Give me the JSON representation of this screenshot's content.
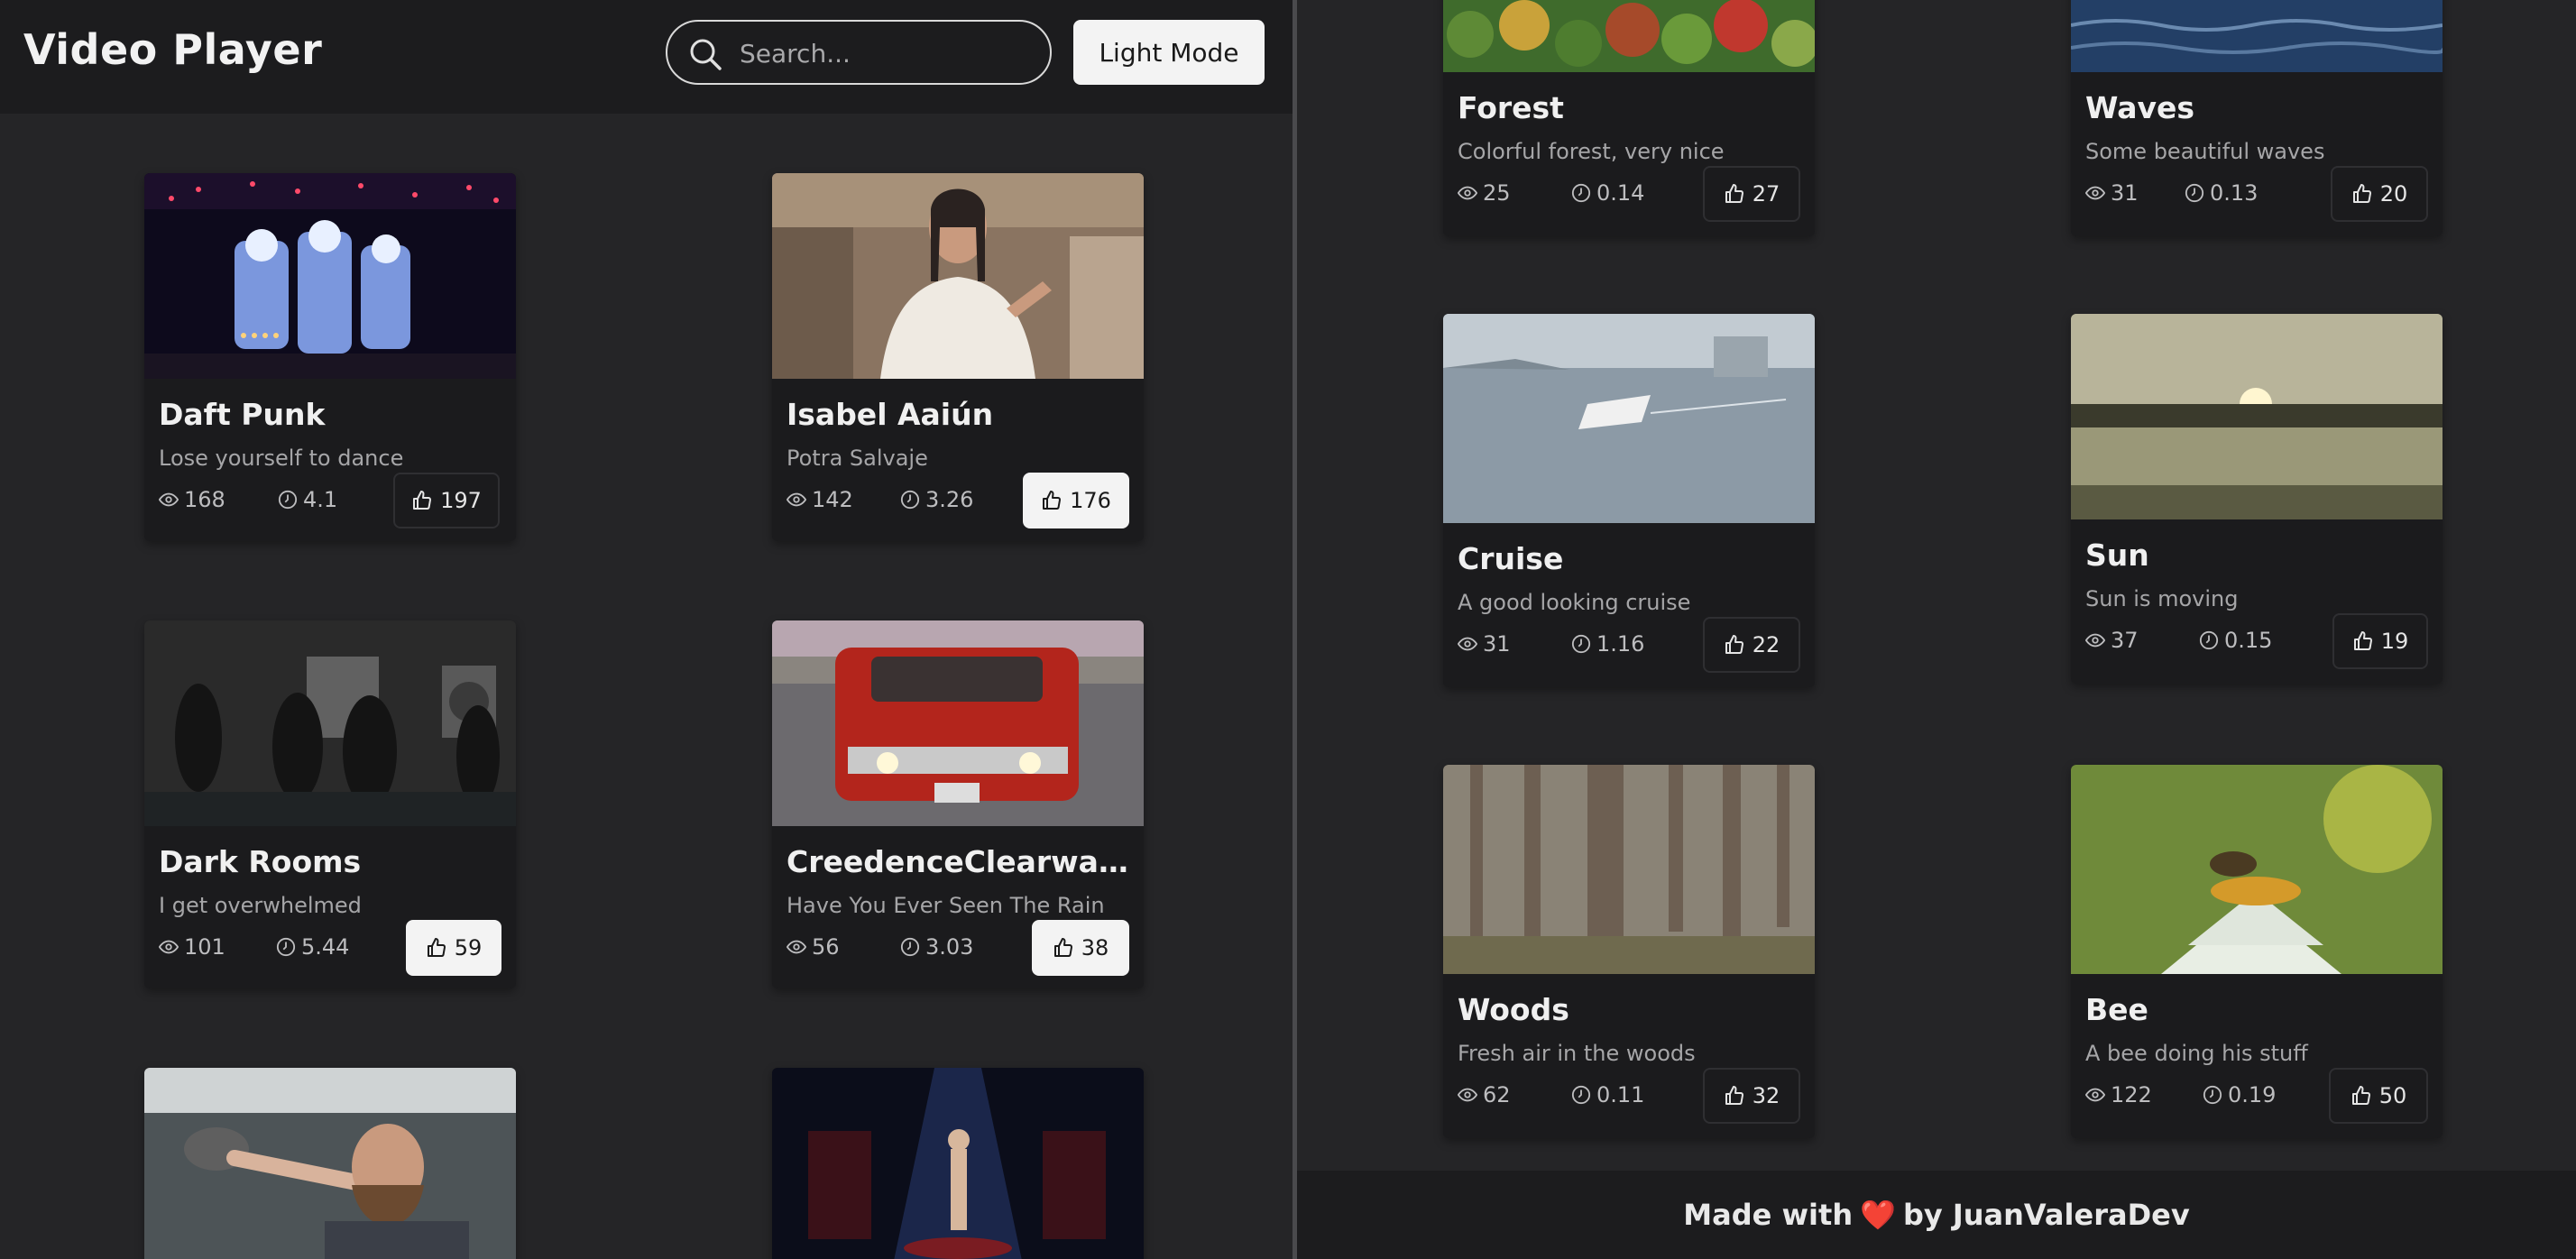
{
  "header": {
    "title": "Video Player",
    "search_placeholder": "Search...",
    "mode_button": "Light Mode"
  },
  "left_cards": [
    {
      "title": "Daft Punk",
      "description": "Lose yourself to dance",
      "views": "168",
      "duration": "4.1",
      "likes": "197",
      "liked": false
    },
    {
      "title": "Isabel Aaiún",
      "description": "Potra Salvaje",
      "views": "142",
      "duration": "3.26",
      "likes": "176",
      "liked": true
    },
    {
      "title": "Dark Rooms",
      "description": "I get overwhelmed",
      "views": "101",
      "duration": "5.44",
      "likes": "59",
      "liked": true
    },
    {
      "title": "CreedenceClearwater...",
      "description": "Have You Ever Seen The Rain",
      "views": "56",
      "duration": "3.03",
      "likes": "38",
      "liked": true
    }
  ],
  "right_cards": [
    {
      "title": "Forest",
      "description": "Colorful forest, very nice",
      "views": "25",
      "duration": "0.14",
      "likes": "27",
      "liked": false
    },
    {
      "title": "Waves",
      "description": "Some beautiful waves",
      "views": "31",
      "duration": "0.13",
      "likes": "20",
      "liked": false
    },
    {
      "title": "Cruise",
      "description": "A good looking cruise",
      "views": "31",
      "duration": "1.16",
      "likes": "22",
      "liked": false
    },
    {
      "title": "Sun",
      "description": "Sun is moving",
      "views": "37",
      "duration": "0.15",
      "likes": "19",
      "liked": false
    },
    {
      "title": "Woods",
      "description": "Fresh air in the woods",
      "views": "62",
      "duration": "0.11",
      "likes": "32",
      "liked": false
    },
    {
      "title": "Bee",
      "description": "A bee doing his stuff",
      "views": "122",
      "duration": "0.19",
      "likes": "50",
      "liked": false
    }
  ],
  "footer": {
    "prefix": "Made with",
    "heart": "❤️",
    "suffix": "by JuanValeraDev"
  },
  "colors": {
    "background": "#252527",
    "header": "#1c1c1e",
    "card": "#1b1b1d",
    "accent_light": "#f3f3f3",
    "heart": "#e53935"
  },
  "icons": [
    "search-icon",
    "eye-icon",
    "clock-icon",
    "thumbs-up-icon"
  ]
}
